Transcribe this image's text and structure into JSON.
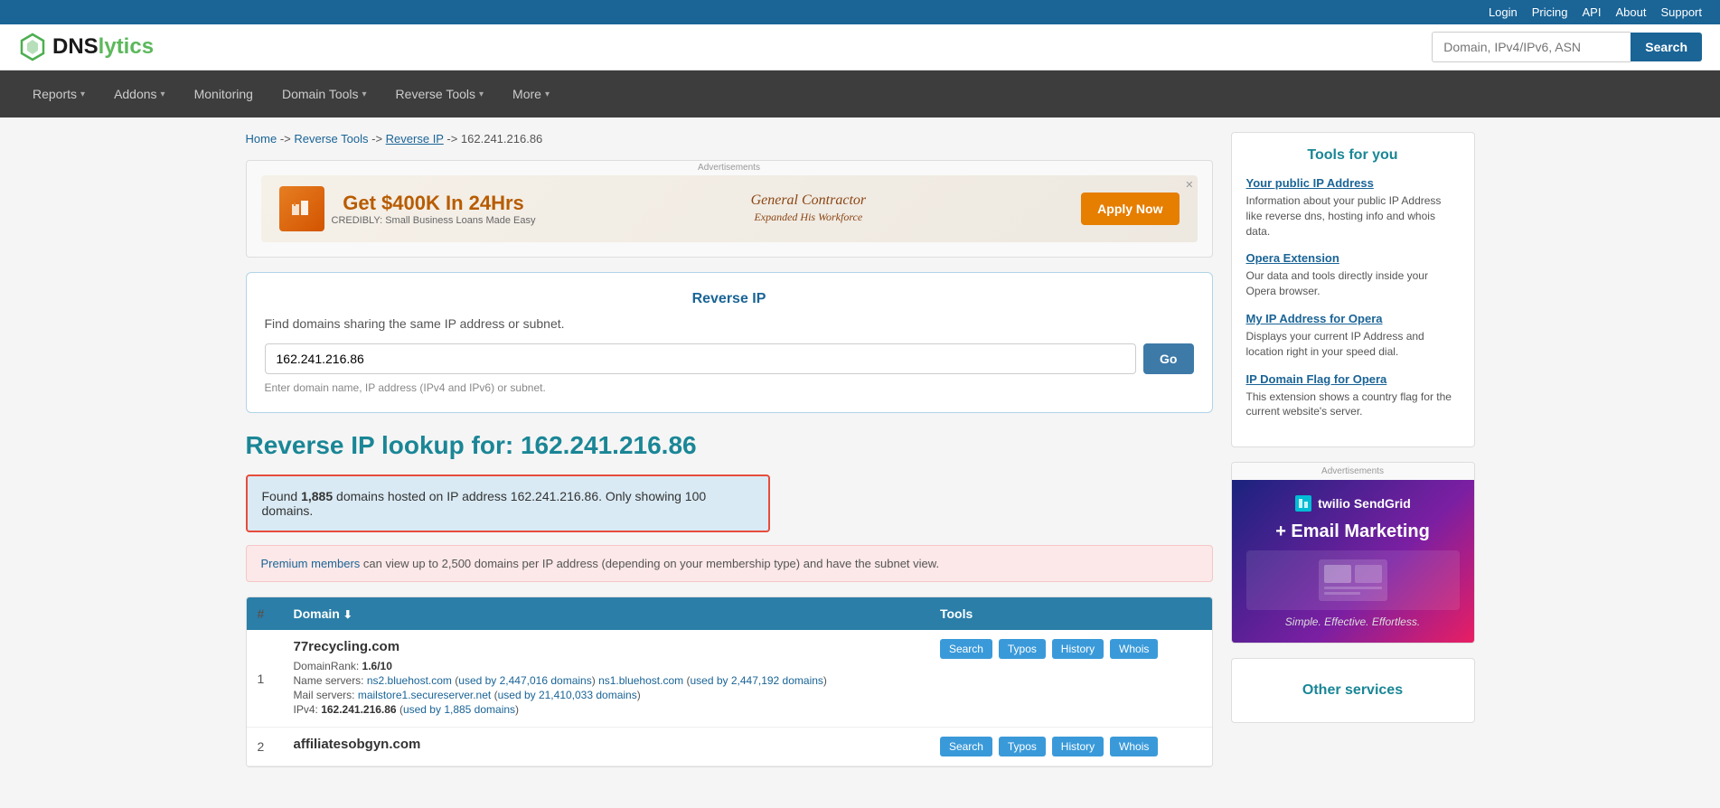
{
  "topbar": {
    "links": [
      "Login",
      "Pricing",
      "API",
      "About",
      "Support"
    ]
  },
  "header": {
    "logo_dns": "DNS",
    "logo_lytics": "lytics",
    "search_placeholder": "Domain, IPv4/IPv6, ASN",
    "search_button": "Search"
  },
  "navbar": {
    "items": [
      {
        "label": "Reports",
        "has_dropdown": true
      },
      {
        "label": "Addons",
        "has_dropdown": true
      },
      {
        "label": "Monitoring",
        "has_dropdown": false
      },
      {
        "label": "Domain Tools",
        "has_dropdown": true
      },
      {
        "label": "Reverse Tools",
        "has_dropdown": true
      },
      {
        "label": "More",
        "has_dropdown": true
      }
    ]
  },
  "breadcrumb": {
    "home": "Home",
    "sep1": "->",
    "reverse_tools": "Reverse Tools",
    "sep2": "->",
    "reverse_ip": "Reverse IP",
    "sep3": "->",
    "ip": "162.241.216.86"
  },
  "ad_banner": {
    "label": "Advertisements",
    "headline": "Get $400K In 24Hrs",
    "sub": "CREDIBLY: Small Business Loans Made Easy",
    "cta": "Apply Now"
  },
  "reverse_ip_box": {
    "title": "Reverse IP",
    "description": "Find domains sharing the same IP address or subnet.",
    "input_value": "162.241.216.86",
    "go_button": "Go",
    "hint": "Enter domain name, IP address (IPv4 and IPv6) or subnet."
  },
  "page_title": "Reverse IP lookup for: 162.241.216.86",
  "info_box": {
    "text_before": "Found ",
    "count": "1,885",
    "text_after": " domains hosted on IP address 162.241.216.86. Only showing 100 domains."
  },
  "premium_box": {
    "link_text": "Premium members",
    "text": " can view up to 2,500 domains per IP address (depending on your membership type) and have the subnet view."
  },
  "table": {
    "headers": [
      "#",
      "Domain",
      "Tools"
    ],
    "rows": [
      {
        "num": "1",
        "domain": "77recycling.com",
        "tools": [
          "Search",
          "Typos",
          "History",
          "Whois"
        ],
        "rank": "1.6/10",
        "nameservers": [
          {
            "ns": "ns2.bluehost.com",
            "used_link": "used by 2,447,016 domains"
          },
          {
            "ns": "ns1.bluehost.com",
            "used_link": "used by 2,447,192 domains"
          }
        ],
        "mail": "mailstore1.secureserver.net",
        "mail_link": "used by 21,410,033 domains",
        "ipv4": "162.241.216.86",
        "ipv4_link": "used by 1,885 domains"
      },
      {
        "num": "2",
        "domain": "affiliatesobgyn.com",
        "tools": [
          "Search",
          "Typos",
          "History",
          "Whois"
        ]
      }
    ]
  },
  "sidebar": {
    "tools_title": "Tools for you",
    "items": [
      {
        "link": "Your public IP Address",
        "desc": "Information about your public IP Address like reverse dns, hosting info and whois data."
      },
      {
        "link": "Opera Extension",
        "desc": "Our data and tools directly inside your Opera browser."
      },
      {
        "link": "My IP Address for Opera",
        "desc": "Displays your current IP Address and location right in your speed dial."
      },
      {
        "link": "IP Domain Flag for Opera",
        "desc": "This extension shows a country flag for the current website's server."
      }
    ],
    "ad_label": "Advertisements",
    "ad_logo": "twilio SendGrid",
    "ad_tagline": "+ Email Marketing",
    "ad_sub": "Simple. Effective. Effortless.",
    "other_title": "Other services"
  }
}
